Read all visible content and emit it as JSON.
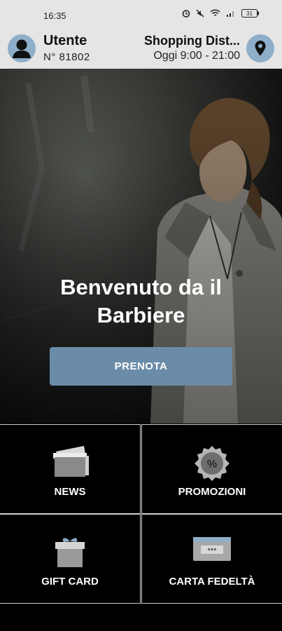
{
  "status_bar": {
    "time": "16:35",
    "battery": "31"
  },
  "header": {
    "user_name": "Utente",
    "user_number": "N° 81802",
    "store_name": "Shopping Dist...",
    "store_hours": "Oggi 9:00 - 21:00"
  },
  "hero": {
    "title_line1": "Benvenuto da il",
    "title_line2": "Barbiere",
    "book_label": "PRENOTA"
  },
  "tiles": [
    {
      "label": "NEWS",
      "icon": "news-icon"
    },
    {
      "label": "PROMOZIONI",
      "icon": "promo-badge-icon"
    },
    {
      "label": "GIFT CARD",
      "icon": "gift-icon"
    },
    {
      "label": "CARTA FEDELTÀ",
      "icon": "loyalty-card-icon"
    }
  ],
  "colors": {
    "accent": "#6b8ca8",
    "avatar_bg": "#8eaec9",
    "header_bg": "#e5e5e5"
  }
}
